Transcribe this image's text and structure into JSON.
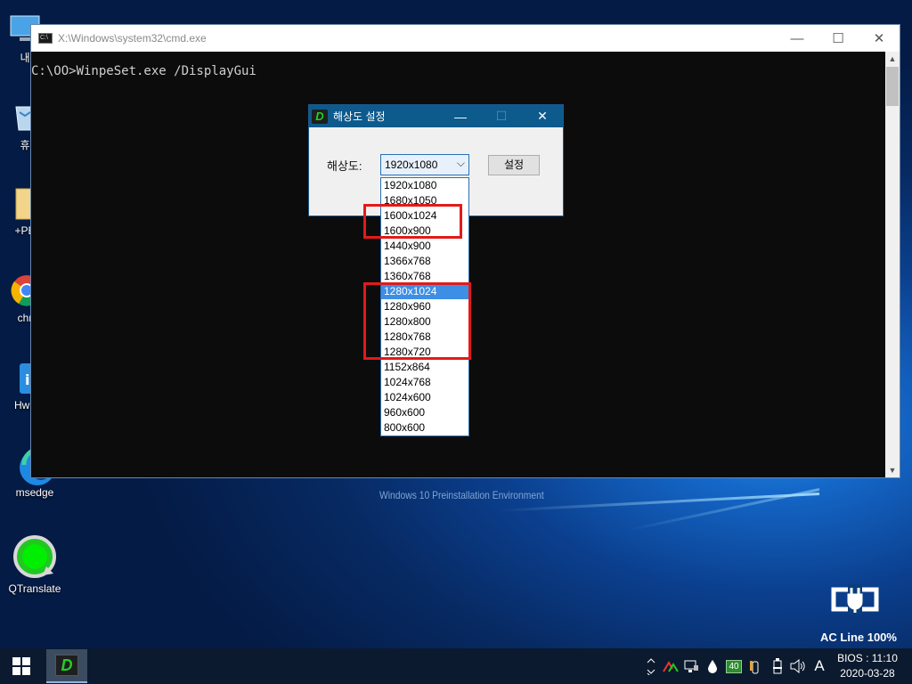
{
  "desktop": {
    "icons": [
      {
        "label": "내",
        "icon": "computer-icon"
      },
      {
        "label": "휴",
        "icon": "recycle-bin-icon"
      },
      {
        "label": "+PE",
        "icon": "folder-icon"
      },
      {
        "label": "chr",
        "icon": "chrome-icon"
      },
      {
        "label": "Hwp",
        "icon": "hwp-icon"
      },
      {
        "label": "msedge",
        "icon": "edge-icon"
      },
      {
        "label": "QTranslate",
        "icon": "qtranslate-icon"
      }
    ],
    "watermark": "Windows 10 Preinstallation Environment",
    "power_status": "AC Line 100%"
  },
  "cmd_window": {
    "title": "X:\\Windows\\system32\\cmd.exe",
    "prompt_line": "C:\\OO>WinpeSet.exe /DisplayGui",
    "buttons": {
      "minimize": "—",
      "maximize": "☐",
      "close": "✕"
    }
  },
  "dialog": {
    "title": "해상도 설정",
    "label": "해상도:",
    "selected": "1920x1080",
    "set_button": "설정",
    "buttons": {
      "minimize": "—",
      "maximize": "☐",
      "close": "✕"
    }
  },
  "dropdown": {
    "options": [
      "1920x1080",
      "1680x1050",
      "1600x1024",
      "1600x900",
      "1440x900",
      "1366x768",
      "1360x768",
      "1280x1024",
      "1280x960",
      "1280x800",
      "1280x768",
      "1280x720",
      "1152x864",
      "1024x768",
      "1024x600",
      "960x600",
      "800x600"
    ],
    "highlighted": "1280x1024"
  },
  "taskbar": {
    "clock_line1": "BIOS : 11:10",
    "clock_line2": "2020-03-28",
    "tray_badge": "40",
    "ime": "A",
    "tray_icons": [
      "chevron-up-icon",
      "network-arrows-icon",
      "network-monitor-icon",
      "drop-icon",
      "badge-40-icon",
      "usb-icon",
      "battery-icon",
      "speaker-icon"
    ]
  },
  "colors": {
    "highlight": "#3d8fe5",
    "red_annotation": "#e21a1a",
    "dialog_title": "#0d5a8c"
  }
}
